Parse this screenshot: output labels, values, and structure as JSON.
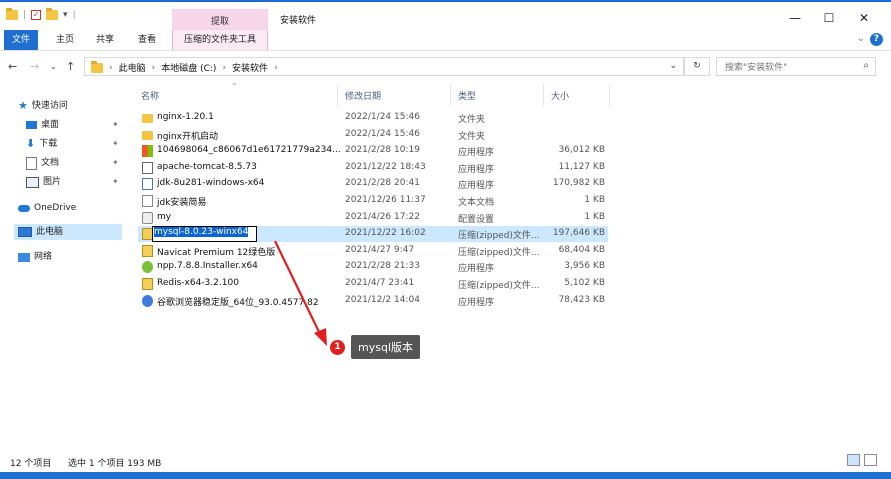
{
  "window": {
    "title": "安装软件",
    "context_tab_group": "提取",
    "controls": {
      "minimize": "—",
      "maximize": "☐",
      "close": "✕"
    }
  },
  "ribbon": {
    "tabs": [
      "文件",
      "主页",
      "共享",
      "查看",
      "压缩的文件夹工具"
    ],
    "help": "?",
    "expand": "⌄"
  },
  "address": {
    "crumbs": [
      "此电脑",
      "本地磁盘 (C:)",
      "安装软件"
    ],
    "refresh": "↻"
  },
  "search": {
    "placeholder": "搜索\"安装软件\""
  },
  "nav": {
    "quick_access": "快速访问",
    "items": [
      "桌面",
      "下载",
      "文档",
      "图片"
    ],
    "onedrive": "OneDrive",
    "this_pc": "此电脑",
    "network": "网络"
  },
  "columns": {
    "name": "名称",
    "date": "修改日期",
    "type": "类型",
    "size": "大小"
  },
  "files": [
    {
      "name": "nginx-1.20.1",
      "date": "2022/1/24 15:46",
      "type": "文件夹",
      "size": "",
      "icon": "folder"
    },
    {
      "name": "nginx开机启动",
      "date": "2022/1/24 15:46",
      "type": "文件夹",
      "size": "",
      "icon": "folder"
    },
    {
      "name": "104698064_c86067d1e61721779a234...",
      "date": "2021/2/28 10:19",
      "type": "应用程序",
      "size": "36,012 KB",
      "icon": "ms"
    },
    {
      "name": "apache-tomcat-8.5.73",
      "date": "2021/12/22 18:43",
      "type": "应用程序",
      "size": "11,127 KB",
      "icon": "exe"
    },
    {
      "name": "jdk-8u281-windows-x64",
      "date": "2021/2/28 20:41",
      "type": "应用程序",
      "size": "170,982 KB",
      "icon": "java"
    },
    {
      "name": "jdk安装简易",
      "date": "2021/12/26 11:37",
      "type": "文本文档",
      "size": "1 KB",
      "icon": "txt"
    },
    {
      "name": "my",
      "date": "2021/4/26 17:22",
      "type": "配置设置",
      "size": "1 KB",
      "icon": "cfg"
    },
    {
      "name": "mysql-8.0.23-winx64",
      "date": "2021/12/22 16:02",
      "type": "压缩(zipped)文件...",
      "size": "197,646 KB",
      "icon": "zip"
    },
    {
      "name": "Navicat Premium 12绿色版",
      "date": "2021/4/27 9:47",
      "type": "压缩(zipped)文件...",
      "size": "68,404 KB",
      "icon": "zip"
    },
    {
      "name": "npp.7.8.8.Installer.x64",
      "date": "2021/2/28 21:33",
      "type": "应用程序",
      "size": "3,956 KB",
      "icon": "npp"
    },
    {
      "name": "Redis-x64-3.2.100",
      "date": "2021/4/7 23:41",
      "type": "压缩(zipped)文件...",
      "size": "5,102 KB",
      "icon": "zip"
    },
    {
      "name": "谷歌浏览器稳定版_64位_93.0.4577.82",
      "date": "2021/12/2 14:04",
      "type": "应用程序",
      "size": "78,423 KB",
      "icon": "browser"
    }
  ],
  "selected_index": 7,
  "status": {
    "count": "12 个项目",
    "selection": "选中 1 个项目  193 MB"
  },
  "annotation": {
    "number": "1",
    "text": "mysql版本",
    "color": "#e02020"
  }
}
